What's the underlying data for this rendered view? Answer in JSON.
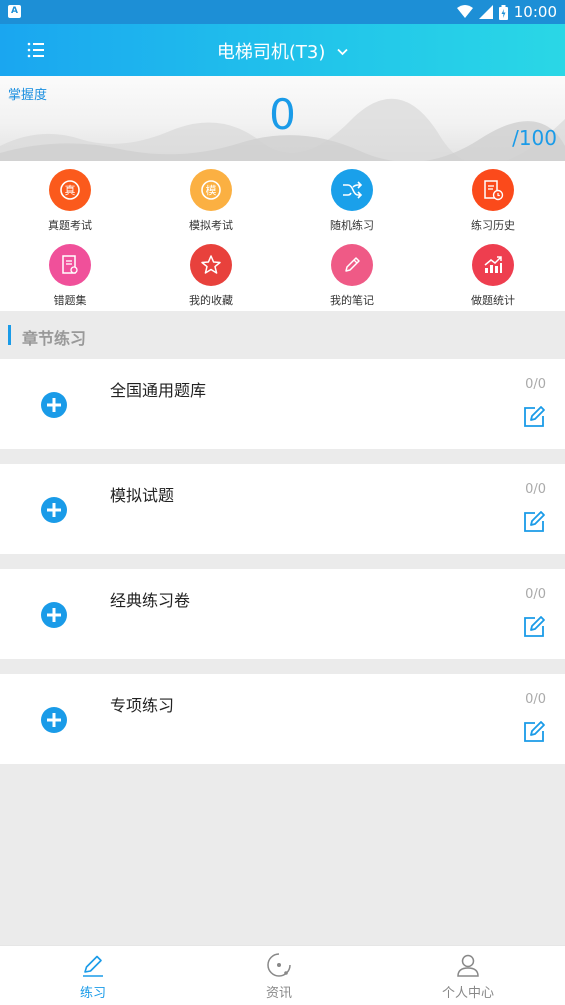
{
  "status_bar": {
    "time": "10:00"
  },
  "header": {
    "title": "电梯司机(T3)",
    "icons": {
      "menu": "menu-icon",
      "dropdown": "chevron-down-icon"
    }
  },
  "mastery": {
    "label": "掌握度",
    "value": "0",
    "total": "/100"
  },
  "quick_actions": [
    {
      "label": "真题考试",
      "icon": "zhen-badge-icon",
      "icon_text": "真",
      "color": "#fb5a1c"
    },
    {
      "label": "模拟考试",
      "icon": "mo-badge-icon",
      "icon_text": "模",
      "color": "#fbb042"
    },
    {
      "label": "随机练习",
      "icon": "shuffle-icon",
      "color": "#1aa0ea"
    },
    {
      "label": "练习历史",
      "icon": "history-doc-icon",
      "color": "#fb4a1b"
    },
    {
      "label": "错题集",
      "icon": "mistake-doc-icon",
      "color": "#f0509a"
    },
    {
      "label": "我的收藏",
      "icon": "star-icon",
      "color": "#e8413c"
    },
    {
      "label": "我的笔记",
      "icon": "pencil-icon",
      "color": "#ef5a86"
    },
    {
      "label": "做题统计",
      "icon": "stats-chart-icon",
      "color": "#ee3e4f"
    }
  ],
  "section": {
    "title": "章节练习"
  },
  "chapters": [
    {
      "title": "全国通用题库",
      "count": "0/0"
    },
    {
      "title": "模拟试题",
      "count": "0/0"
    },
    {
      "title": "经典练习卷",
      "count": "0/0"
    },
    {
      "title": "专项练习",
      "count": "0/0"
    }
  ],
  "bottom_nav": [
    {
      "label": "练习",
      "icon": "pencil-icon",
      "active": true
    },
    {
      "label": "资讯",
      "icon": "news-icon",
      "active": false
    },
    {
      "label": "个人中心",
      "icon": "user-icon",
      "active": false
    }
  ],
  "colors": {
    "accent": "#1a9be8",
    "header_start": "#1aa6f0",
    "header_end": "#2ad7e6",
    "inactive_nav": "#888888"
  }
}
